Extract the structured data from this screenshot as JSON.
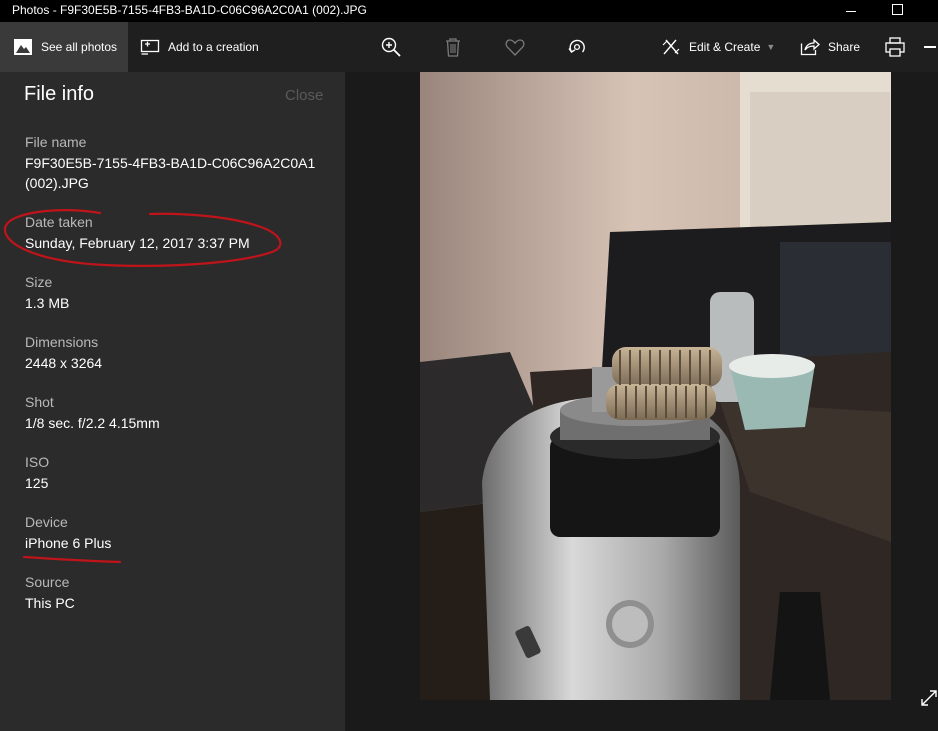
{
  "window": {
    "title": "Photos - F9F30E5B-7155-4FB3-BA1D-C06C96A2C0A1 (002).JPG"
  },
  "toolbar": {
    "see_all_label": "See all photos",
    "add_label": "Add to a creation",
    "edit_label": "Edit & Create",
    "share_label": "Share"
  },
  "file_info": {
    "title": "File info",
    "close_label": "Close",
    "fields": [
      {
        "label": "File name",
        "value": "F9F30E5B-7155-4FB3-BA1D-C06C96A2C0A1 (002).JPG"
      },
      {
        "label": "Date taken",
        "value": "Sunday, February 12, 2017 3:37 PM"
      },
      {
        "label": "Size",
        "value": "1.3 MB"
      },
      {
        "label": "Dimensions",
        "value": "2448 x 3264"
      },
      {
        "label": "Shot",
        "value": "1/8 sec. f/2.2 4.15mm"
      },
      {
        "label": "ISO",
        "value": "125"
      },
      {
        "label": "Device",
        "value": "iPhone 6 Plus"
      },
      {
        "label": "Source",
        "value": "This PC"
      }
    ]
  },
  "colors": {
    "annotation": "#c0141b",
    "panel_bg": "#2b2b2b",
    "toolbar_bg": "#1f1f1f",
    "titlebar_bg": "#000000"
  }
}
